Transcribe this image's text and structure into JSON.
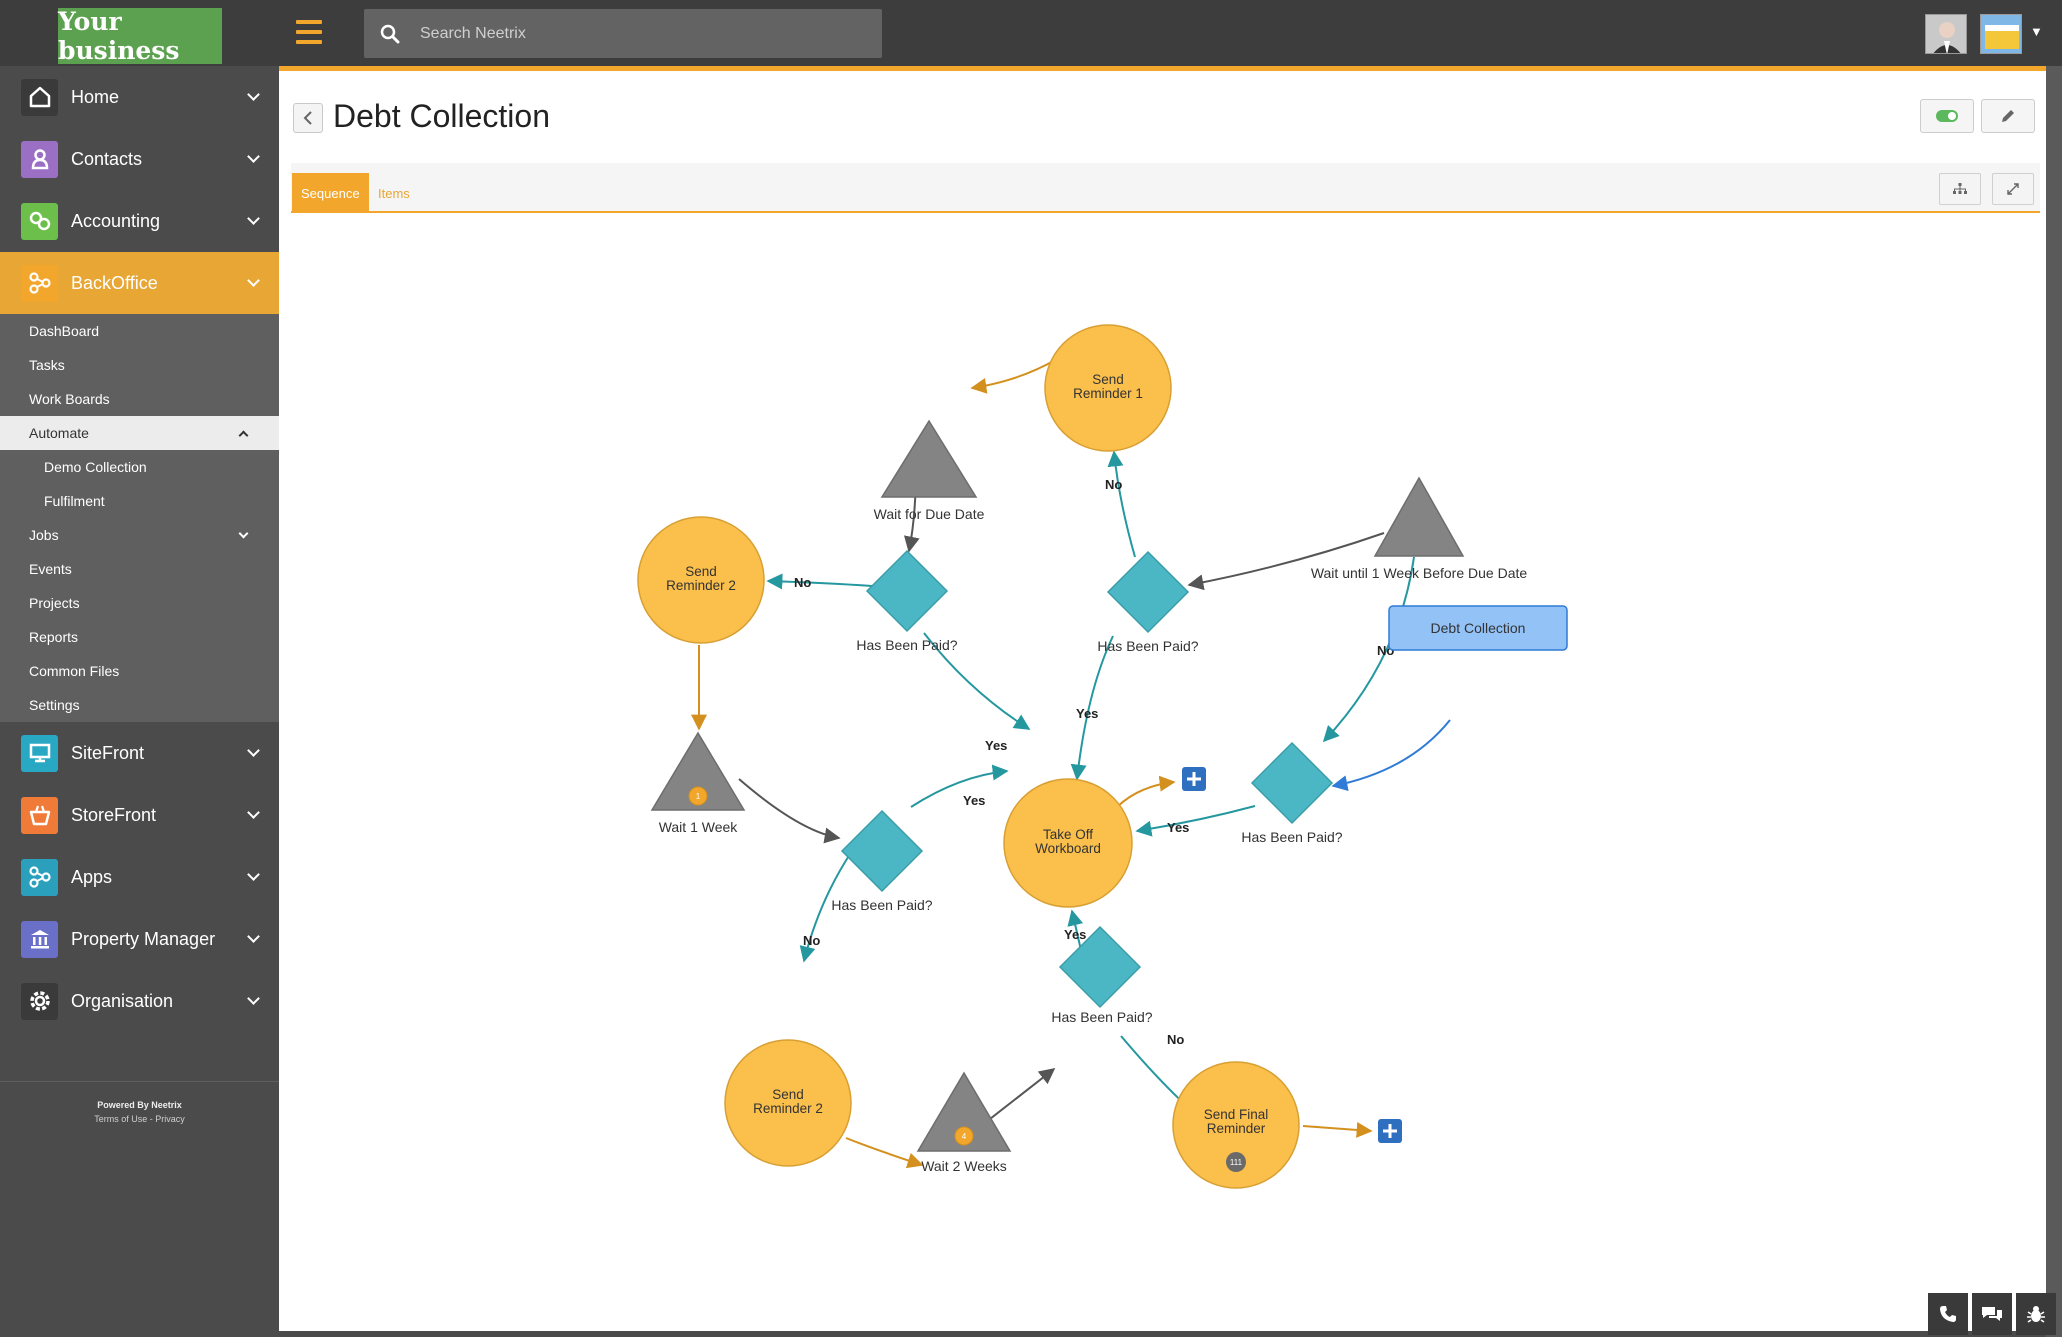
{
  "brand": {
    "logo_text": "Your business"
  },
  "search": {
    "placeholder": "Search Neetrix"
  },
  "sidebar": {
    "items": [
      {
        "label": "Home",
        "icon": "home-icon",
        "color": "#3a3a3a"
      },
      {
        "label": "Contacts",
        "icon": "user-icon",
        "color": "#9a6fc4"
      },
      {
        "label": "Accounting",
        "icon": "link-icon",
        "color": "#6cbf4a"
      },
      {
        "label": "BackOffice",
        "icon": "nodes-icon",
        "color": "#f2a72c"
      },
      {
        "label": "SiteFront",
        "icon": "monitor-icon",
        "color": "#29a8c4"
      },
      {
        "label": "StoreFront",
        "icon": "basket-icon",
        "color": "#f07b38"
      },
      {
        "label": "Apps",
        "icon": "nodes-icon",
        "color": "#2aa0bd"
      },
      {
        "label": "Property Manager",
        "icon": "building-icon",
        "color": "#6a70c8"
      },
      {
        "label": "Organisation",
        "icon": "gear-icon",
        "color": "#3a3a3a"
      }
    ],
    "backoffice_sub": {
      "dashboard": "DashBoard",
      "tasks": "Tasks",
      "work_boards": "Work Boards",
      "automate": "Automate",
      "demo_collection": "Demo Collection",
      "fulfilment": "Fulfilment",
      "jobs": "Jobs",
      "events": "Events",
      "projects": "Projects",
      "reports": "Reports",
      "common_files": "Common Files",
      "settings": "Settings"
    },
    "footer": {
      "powered": "Powered By Neetrix",
      "terms": "Terms of Use",
      "sep": " - ",
      "privacy": "Privacy"
    }
  },
  "page": {
    "title": "Debt Collection"
  },
  "tabs": {
    "sequence": "Sequence",
    "items": "Items"
  },
  "colors": {
    "accent": "#f2a72c",
    "circle": "#fbbf4c",
    "diamond": "#4bb7c4",
    "triangle": "#848484",
    "trigger": "#93c2f7",
    "teal_edge": "#25979f",
    "orange_edge": "#d4901e",
    "plus": "#2f6fc0"
  },
  "diagram": {
    "nodes": {
      "send_reminder_1": [
        "Send",
        "Reminder 1"
      ],
      "wait_due": "Wait for Due Date",
      "wait_week_before": "Wait until 1 Week Before Due Date",
      "paid_top": "Has Been Paid?",
      "send_reminder_2a": [
        "Send",
        "Reminder 2"
      ],
      "paid_left": "Has Been Paid?",
      "trigger": "Debt Collection",
      "paid_right": "Has Been Paid?",
      "take_off": [
        "Take Off",
        "Workboard"
      ],
      "wait_1_week": "Wait 1 Week",
      "wait_1_week_badge": "1",
      "paid_mid": "Has Been Paid?",
      "send_reminder_2b": [
        "Send",
        "Reminder 2"
      ],
      "paid_bottom": "Has Been Paid?",
      "wait_2_weeks": "Wait 2 Weeks",
      "wait_2_weeks_badge": "4",
      "send_final": [
        "Send Final",
        "Reminder"
      ],
      "send_final_badge": "111"
    },
    "edges": {
      "no": "No",
      "yes": "Yes"
    }
  }
}
